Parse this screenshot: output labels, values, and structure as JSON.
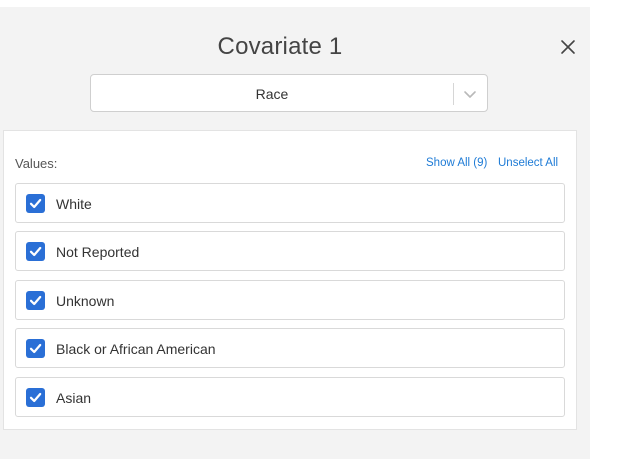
{
  "dialog": {
    "title": "Covariate 1",
    "close_icon": "close-icon"
  },
  "selector": {
    "value": "Race",
    "chevron_icon": "chevron-down-icon"
  },
  "values": {
    "label": "Values:",
    "show_all_label": "Show All (9)",
    "unselect_all_label": "Unselect All",
    "items": [
      {
        "label": "White",
        "checked": true
      },
      {
        "label": "Not Reported",
        "checked": true
      },
      {
        "label": "Unknown",
        "checked": true
      },
      {
        "label": "Black or African American",
        "checked": true
      },
      {
        "label": "Asian",
        "checked": true
      }
    ]
  },
  "colors": {
    "accent": "#2a6fd6",
    "link": "#1e7bd6",
    "panel_bg": "#f3f3f3"
  }
}
